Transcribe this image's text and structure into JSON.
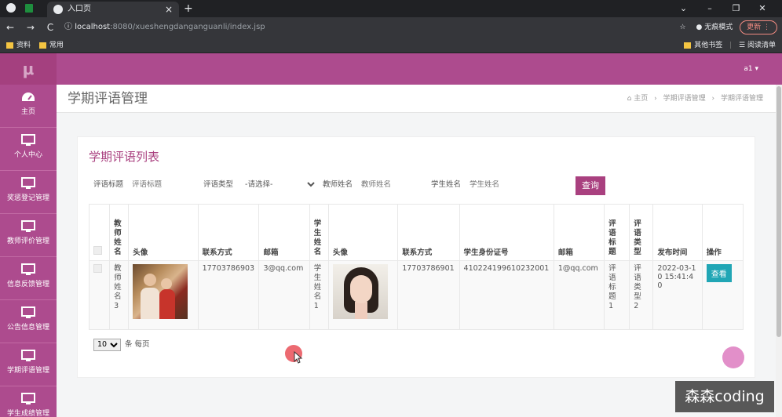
{
  "browser": {
    "tab_title": "入口页",
    "url_host": "localhost",
    "url_rest": ":8080/xueshengdanganguanli/index.jsp",
    "incognito_label": "无痕模式",
    "update_label": "更新",
    "bookmarks": [
      "资料",
      "常用"
    ],
    "other_bookmarks": "其他书签",
    "reading_list": "阅读清单"
  },
  "app": {
    "logo": "μ",
    "user": "a1",
    "sidebar": [
      {
        "label": "主页",
        "icon": "dashboard-icon"
      },
      {
        "label": "个人中心",
        "icon": "monitor-icon"
      },
      {
        "label": "奖惩登记管理",
        "icon": "monitor-icon"
      },
      {
        "label": "教师评价管理",
        "icon": "monitor-icon"
      },
      {
        "label": "信息反馈管理",
        "icon": "monitor-icon"
      },
      {
        "label": "公告信息管理",
        "icon": "monitor-icon"
      },
      {
        "label": "学期评语管理",
        "icon": "monitor-icon"
      },
      {
        "label": "学生成绩管理",
        "icon": "monitor-icon"
      }
    ],
    "page_title": "学期评语管理",
    "breadcrumb": [
      "主页",
      "学期评语管理",
      "学期评语管理"
    ]
  },
  "card": {
    "title": "学期评语列表",
    "filters": {
      "title_label": "评语标题",
      "title_placeholder": "评语标题",
      "type_label": "评语类型",
      "type_selected": "-请选择-",
      "teacher_label": "教师姓名",
      "teacher_placeholder": "教师姓名",
      "student_label": "学生姓名",
      "student_placeholder": "学生姓名",
      "query_button": "查询"
    },
    "columns": [
      "教师姓名",
      "头像",
      "联系方式",
      "邮箱",
      "学生姓名",
      "头像",
      "联系方式",
      "学生身份证号",
      "邮箱",
      "评语标题",
      "评语类型",
      "发布时间",
      "操作"
    ],
    "rows": [
      {
        "teacher_name": "教师姓名3",
        "teacher_phone": "17703786903",
        "teacher_email": "3@qq.com",
        "student_name": "学生姓名1",
        "student_phone": "17703786901",
        "student_id": "410224199610232001",
        "student_email": "1@qq.com",
        "comment_title": "评语标题1",
        "comment_type": "评语类型2",
        "publish_time": "2022-03-10 15:41:40",
        "action": "查看"
      }
    ],
    "page_size": "10",
    "page_size_suffix": "条 每页"
  },
  "overlay": {
    "watermark": "森森coding"
  },
  "colors": {
    "brand": "#ad4b8e",
    "accent_title": "#a9407f",
    "view_button": "#21a6b5"
  }
}
